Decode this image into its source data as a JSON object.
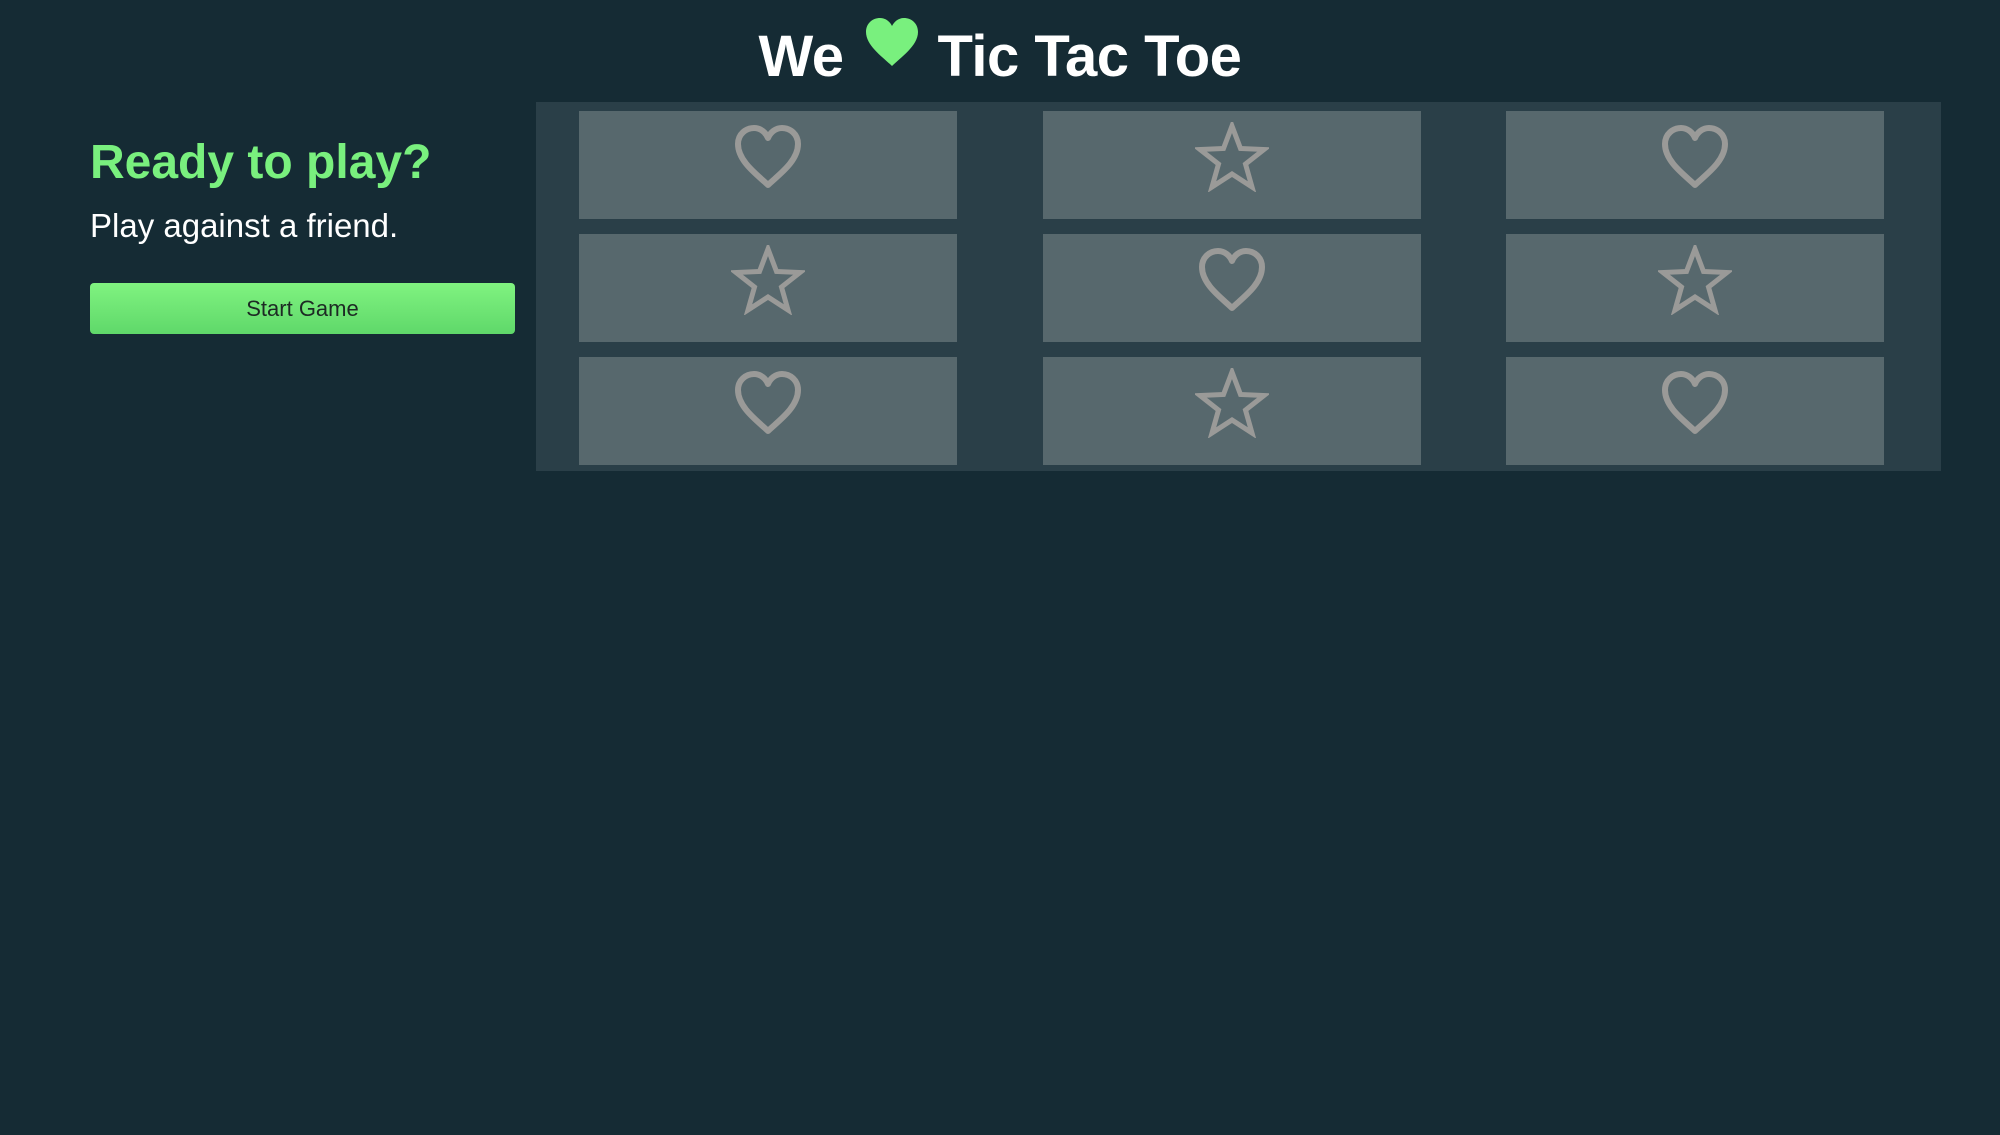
{
  "header": {
    "title_before": "We",
    "title_icon": "heart-icon",
    "title_after": "Tic Tac Toe"
  },
  "sidebar": {
    "heading": "Ready to play?",
    "subtitle": "Play against a friend.",
    "start_button_label": "Start Game"
  },
  "board": {
    "cells": [
      {
        "mark": "heart-icon"
      },
      {
        "mark": "star-icon"
      },
      {
        "mark": "heart-icon"
      },
      {
        "mark": "star-icon"
      },
      {
        "mark": "heart-icon"
      },
      {
        "mark": "star-icon"
      },
      {
        "mark": "heart-icon"
      },
      {
        "mark": "star-icon"
      },
      {
        "mark": "heart-icon"
      }
    ]
  },
  "colors": {
    "background": "#152b34",
    "board_background": "#2a3f48",
    "cell_background": "#57686d",
    "accent_green": "#79f07e",
    "mark_outline": "#9a9a98",
    "title_text": "#ffffff"
  }
}
